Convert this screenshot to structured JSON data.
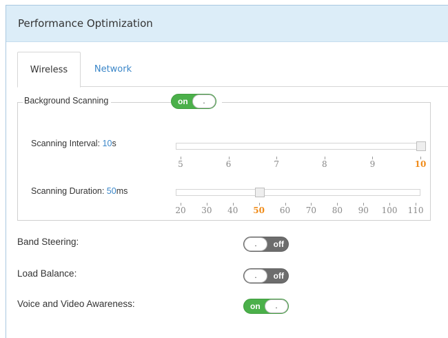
{
  "panel": {
    "title": "Performance Optimization"
  },
  "tabs": [
    {
      "label": "Wireless",
      "active": true
    },
    {
      "label": "Network",
      "active": false
    }
  ],
  "background_scanning": {
    "label": "Background Scanning",
    "toggle": {
      "state": "on",
      "text": "on",
      "knob": "."
    }
  },
  "scanning_interval": {
    "label": "Scanning Interval: ",
    "value": "10",
    "unit": "s",
    "ticks": [
      "5",
      "6",
      "7",
      "8",
      "9",
      "10"
    ],
    "selected": "10",
    "level": 1.0
  },
  "scanning_duration": {
    "label": "Scanning Duration: ",
    "value": "50",
    "unit": "ms",
    "ticks": [
      "20",
      "30",
      "40",
      "50",
      "60",
      "70",
      "80",
      "90",
      "100",
      "110"
    ],
    "selected": "50",
    "level": 0.333
  },
  "settings": [
    {
      "label": "Band Steering:",
      "state": "off",
      "text": "off",
      "knob": "."
    },
    {
      "label": "Load Balance:",
      "state": "off",
      "text": "off",
      "knob": "."
    },
    {
      "label": "Voice and Video Awareness:",
      "state": "on",
      "text": "on",
      "knob": "."
    }
  ],
  "colors": {
    "accent": "#3a86c8",
    "toggle_on": "#4bb04a",
    "toggle_off": "#6d6d6d",
    "active_tick": "#f08c1a"
  }
}
